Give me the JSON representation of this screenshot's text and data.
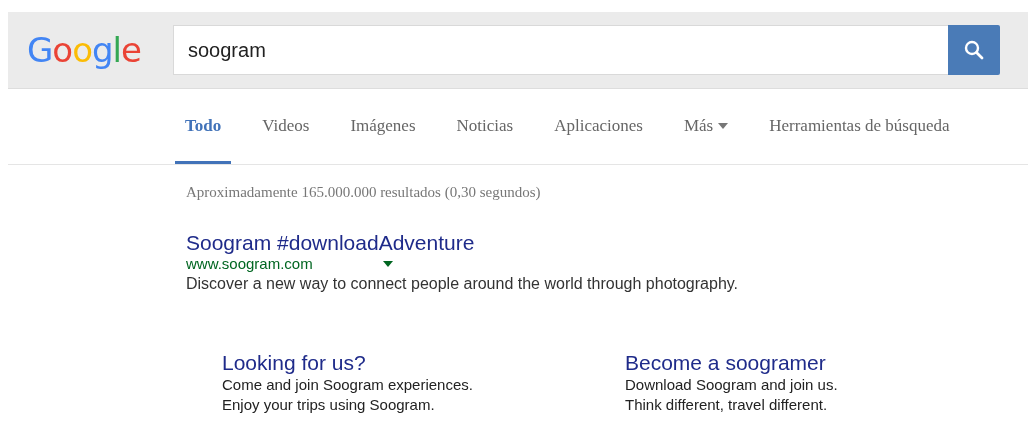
{
  "logo": "Google",
  "search": {
    "value": "soogram"
  },
  "tabs": [
    {
      "label": "Todo",
      "selected": true
    },
    {
      "label": "Videos",
      "selected": false
    },
    {
      "label": "Imágenes",
      "selected": false
    },
    {
      "label": "Noticias",
      "selected": false
    },
    {
      "label": "Aplicaciones",
      "selected": false
    },
    {
      "label": "Más",
      "selected": false,
      "dropdown": true
    },
    {
      "label": "Herramientas de búsqueda",
      "selected": false
    }
  ],
  "result_stats": "Aproximadamente 165.000.000 resultados (0,30 segundos)",
  "result": {
    "title": "Soogram #downloadAdventure",
    "url": "www.soogram.com",
    "snippet": "Discover a new way to connect people around the world through photography."
  },
  "sitelinks": [
    {
      "title": "Looking for us?",
      "lines": [
        "Come and join Soogram experiences.",
        "Enjoy your trips using Soogram."
      ]
    },
    {
      "title": "Become a soogramer",
      "lines": [
        "Download Soogram and join us.",
        "Think different, travel different."
      ]
    }
  ]
}
